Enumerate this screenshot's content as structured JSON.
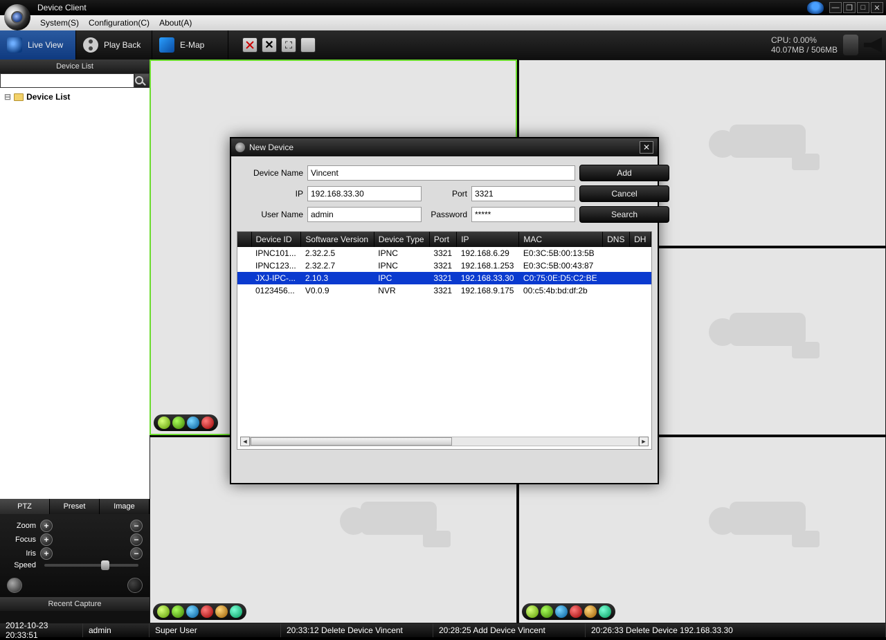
{
  "app": {
    "title": "Device Client"
  },
  "menu": {
    "system": "System(S)",
    "config": "Configuration(C)",
    "about": "About(A)"
  },
  "toolbar": {
    "live": "Live View",
    "playback": "Play Back",
    "emap": "E-Map",
    "cpu_line1": "CPU: 0.00%",
    "cpu_line2": "40.07MB / 506MB"
  },
  "sidebar": {
    "header": "Device List",
    "search_placeholder": "",
    "tree_root": "Device List"
  },
  "ptz": {
    "tabs": {
      "ptz": "PTZ",
      "preset": "Preset",
      "image": "Image"
    },
    "zoom": "Zoom",
    "focus": "Focus",
    "iris": "Iris",
    "speed": "Speed",
    "plus": "+",
    "minus": "−",
    "recent": "Recent Capture"
  },
  "modal": {
    "title": "New Device",
    "labels": {
      "device_name": "Device Name",
      "ip": "IP",
      "port": "Port",
      "user": "User Name",
      "password": "Password"
    },
    "values": {
      "device_name": "Vincent",
      "ip": "192.168.33.30",
      "port": "3321",
      "user": "admin",
      "password": "*****"
    },
    "buttons": {
      "add": "Add",
      "cancel": "Cancel",
      "search": "Search"
    },
    "columns": {
      "id": "Device ID",
      "sw": "Software Version",
      "type": "Device Type",
      "port": "Port",
      "ip": "IP",
      "mac": "MAC",
      "dns": "DNS",
      "dh": "DH"
    },
    "rows": [
      {
        "id": "IPNC101...",
        "sw": "2.32.2.5",
        "type": "IPNC",
        "port": "3321",
        "ip": "192.168.6.29",
        "mac": "E0:3C:5B:00:13:5B",
        "selected": false
      },
      {
        "id": "IPNC123...",
        "sw": "2.32.2.7",
        "type": "IPNC",
        "port": "3321",
        "ip": "192.168.1.253",
        "mac": "E0:3C:5B:00:43:87",
        "selected": false
      },
      {
        "id": "JXJ-IPC-...",
        "sw": "2.10.3",
        "type": "IPC",
        "port": "3321",
        "ip": "192.168.33.30",
        "mac": "C0:75:0E:D5:C2:BE",
        "selected": true
      },
      {
        "id": "0123456...",
        "sw": "V0.0.9",
        "type": "NVR",
        "port": "3321",
        "ip": "192.168.9.175",
        "mac": "00:c5:4b:bd:df:2b",
        "selected": false
      }
    ]
  },
  "status": {
    "datetime": "2012-10-23 20:33:51",
    "user": "admin",
    "role": "Super User",
    "log1": "20:33:12 Delete Device Vincent",
    "log2": "20:28:25 Add Device Vincent",
    "log3": "20:26:33 Delete Device 192.168.33.30"
  }
}
